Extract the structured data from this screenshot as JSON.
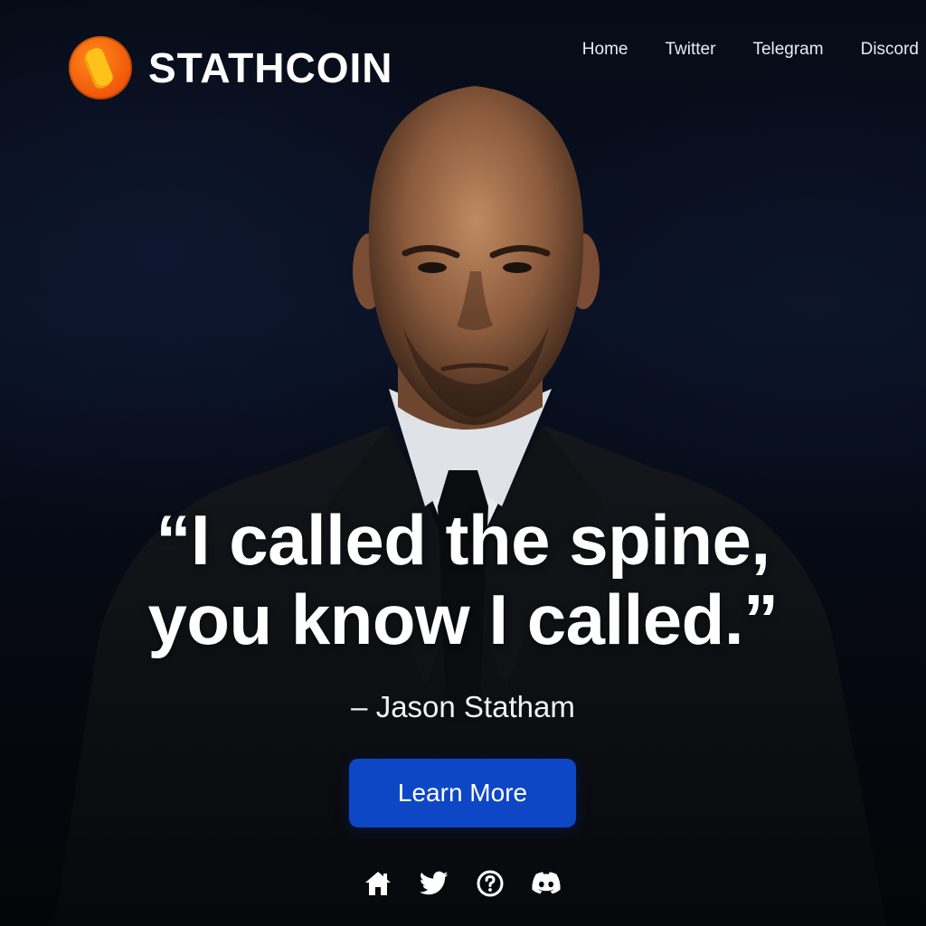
{
  "brand": {
    "name": "STATHCOIN",
    "logo_icon": "coin-logo-icon"
  },
  "nav": {
    "items": [
      {
        "label": "Home"
      },
      {
        "label": "Twitter"
      },
      {
        "label": "Telegram"
      },
      {
        "label": "Discord"
      }
    ]
  },
  "hero": {
    "quote_line1": "“I called the spine,",
    "quote_line2": "you know I called.”",
    "author": "– Jason Statham",
    "cta_label": "Learn More"
  },
  "socials": [
    {
      "icon": "home-icon"
    },
    {
      "icon": "twitter-icon"
    },
    {
      "icon": "help-circle-icon"
    },
    {
      "icon": "discord-icon"
    }
  ],
  "colors": {
    "background": "#05070c",
    "accent": "#0d47c6",
    "logo_orange": "#f0560a",
    "logo_yellow": "#ffc21a",
    "text": "#ffffff"
  }
}
